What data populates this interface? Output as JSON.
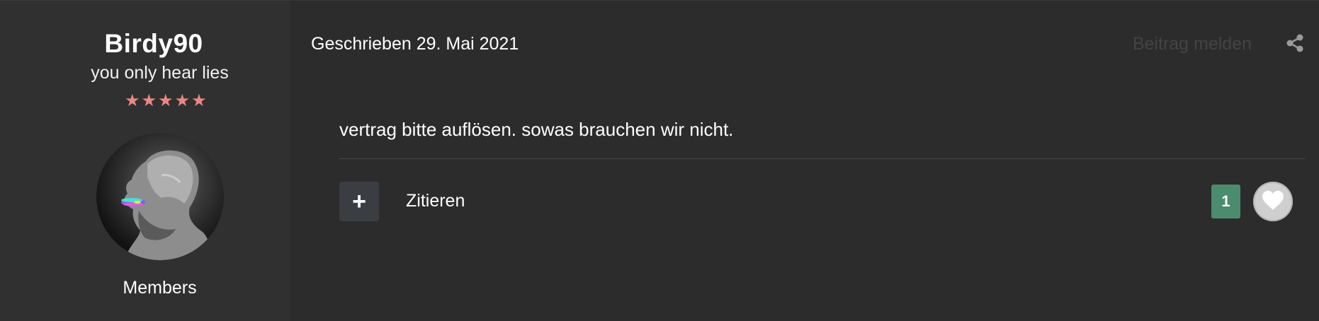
{
  "author": {
    "name": "Birdy90",
    "title": "you only hear lies",
    "rank_stars": [
      "★",
      "★",
      "★",
      "★",
      "★"
    ],
    "group": "Members"
  },
  "post": {
    "date": "Geschrieben 29. Mai 2021",
    "report_label": "Beitrag melden",
    "body": "vertrag bitte auflösen. sowas brauchen wir nicht.",
    "plus_label": "+",
    "quote_label": "Zitieren",
    "reaction_count": "1"
  },
  "colors": {
    "background": "#2c2c2c",
    "author_panel": "#303030",
    "reaction_badge": "#4a8c6d",
    "report_link": "#444444",
    "star": "#e48a86"
  },
  "icons": {
    "share": "share-icon",
    "like": "heart-icon"
  }
}
